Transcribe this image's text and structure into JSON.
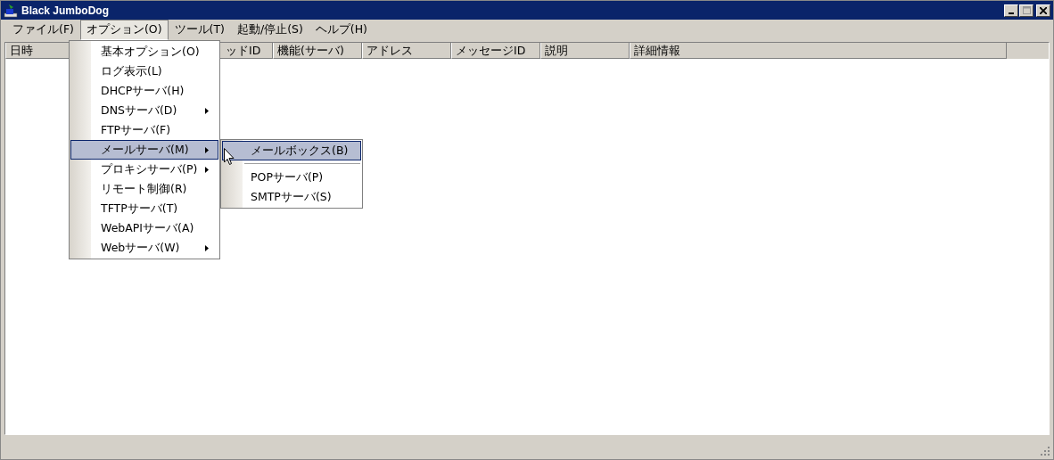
{
  "window": {
    "title": "Black JumboDog"
  },
  "menubar": [
    {
      "label": "ファイル(F)",
      "selected": false
    },
    {
      "label": "オプション(O)",
      "selected": true
    },
    {
      "label": "ツール(T)",
      "selected": false
    },
    {
      "label": "起動/停止(S)",
      "selected": false
    },
    {
      "label": "ヘルプ(H)",
      "selected": false
    }
  ],
  "table": {
    "columns": [
      "日時",
      "ッドID",
      "機能(サーバ)",
      "アドレス",
      "メッセージID",
      "説明",
      "詳細情報"
    ]
  },
  "menu": {
    "items": [
      {
        "label": "基本オプション(O)",
        "submenu": false,
        "selected": false
      },
      {
        "label": "ログ表示(L)",
        "submenu": false,
        "selected": false
      },
      {
        "label": "DHCPサーバ(H)",
        "submenu": false,
        "selected": false
      },
      {
        "label": "DNSサーバ(D)",
        "submenu": true,
        "selected": false
      },
      {
        "label": "FTPサーバ(F)",
        "submenu": false,
        "selected": false
      },
      {
        "label": "メールサーバ(M)",
        "submenu": true,
        "selected": true
      },
      {
        "label": "プロキシサーバ(P)",
        "submenu": true,
        "selected": false
      },
      {
        "label": "リモート制御(R)",
        "submenu": false,
        "selected": false
      },
      {
        "label": "TFTPサーバ(T)",
        "submenu": false,
        "selected": false
      },
      {
        "label": "WebAPIサーバ(A)",
        "submenu": false,
        "selected": false
      },
      {
        "label": "Webサーバ(W)",
        "submenu": true,
        "selected": false
      }
    ]
  },
  "submenu": {
    "items": [
      {
        "kind": "item",
        "label": "メールボックス(B)",
        "selected": true
      },
      {
        "kind": "separator"
      },
      {
        "kind": "item",
        "label": "POPサーバ(P)",
        "selected": false
      },
      {
        "kind": "item",
        "label": "SMTPサーバ(S)",
        "selected": false
      }
    ]
  }
}
